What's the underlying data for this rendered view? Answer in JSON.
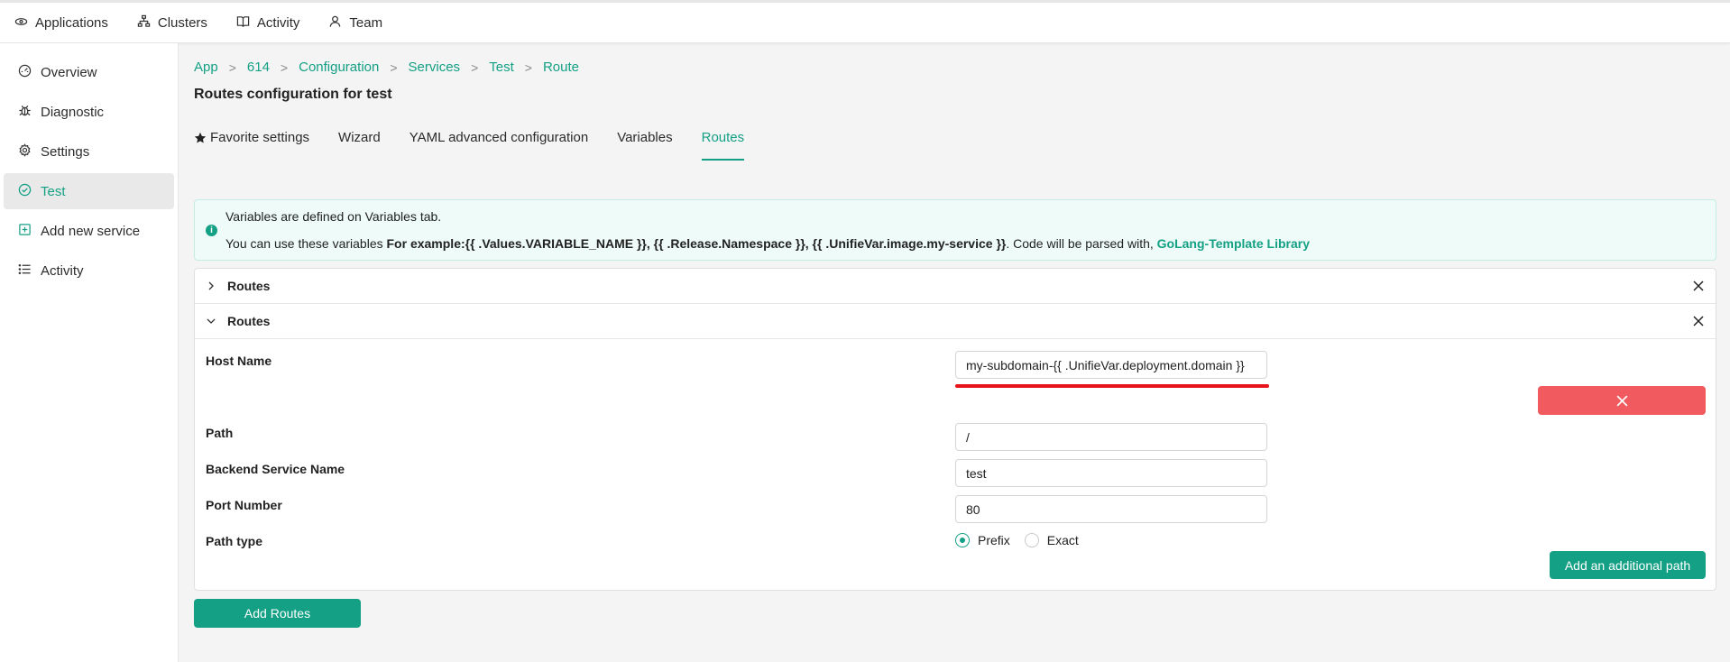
{
  "topnav": {
    "items": [
      {
        "label": "Applications",
        "icon": "cloud-icon"
      },
      {
        "label": "Clusters",
        "icon": "sitemap-icon"
      },
      {
        "label": "Activity",
        "icon": "book-icon"
      },
      {
        "label": "Team",
        "icon": "user-icon"
      }
    ]
  },
  "sidebar": {
    "items": [
      {
        "label": "Overview",
        "icon": "dashboard-icon"
      },
      {
        "label": "Diagnostic",
        "icon": "bug-icon"
      },
      {
        "label": "Settings",
        "icon": "gear-icon"
      },
      {
        "label": "Test",
        "icon": "check-circle-icon",
        "active": true
      },
      {
        "label": "Add new service",
        "icon": "plus-square-icon"
      },
      {
        "label": "Activity",
        "icon": "list-icon"
      }
    ]
  },
  "breadcrumb": [
    "App",
    "614",
    "Configuration",
    "Services",
    "Test",
    "Route"
  ],
  "page_title": "Routes configuration for test",
  "tabs": [
    {
      "label": "Favorite settings",
      "icon": "star-icon"
    },
    {
      "label": "Wizard"
    },
    {
      "label": "YAML advanced configuration"
    },
    {
      "label": "Variables"
    },
    {
      "label": "Routes",
      "active": true
    }
  ],
  "info": {
    "line1": "Variables are defined on Variables tab.",
    "line2_prefix": "You can use these variables ",
    "line2_example": "For example:{{ .Values.VARIABLE_NAME }}, {{ .Release.Namespace }}, {{ .UnifieVar.image.my-service }}",
    "line2_suffix": ". Code will be parsed with, ",
    "line2_link": "GoLang-Template Library"
  },
  "routes": {
    "collapsed_title": "Routes",
    "expanded_title": "Routes",
    "host_name_label": "Host Name",
    "host_name_value": "my-subdomain-{{ .UnifieVar.deployment.domain }}",
    "path_label": "Path",
    "path_value": "/",
    "backend_label": "Backend Service Name",
    "backend_value": "test",
    "port_label": "Port Number",
    "port_value": "80",
    "path_type_label": "Path type",
    "path_type_options": [
      "Prefix",
      "Exact"
    ],
    "path_type_selected": "Prefix",
    "add_path_label": "Add an additional path",
    "add_routes_label": "Add Routes"
  },
  "colors": {
    "accent": "#14a085",
    "danger": "#f15b5f",
    "highlight": "#e8141c"
  }
}
